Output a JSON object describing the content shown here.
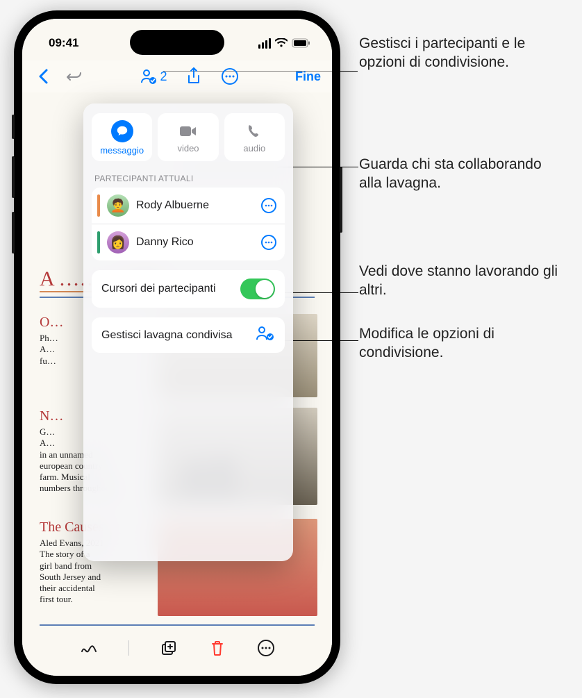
{
  "status": {
    "time": "09:41"
  },
  "toolbar": {
    "collab_count": "2",
    "done_label": "Fine"
  },
  "popover": {
    "contacts": {
      "message": "messaggio",
      "video": "video",
      "audio": "audio"
    },
    "participants_header": "PARTECIPANTI ATTUALI",
    "participants": [
      {
        "name": "Rody Albuerne",
        "presence": "#e98b4a"
      },
      {
        "name": "Danny Rico",
        "presence": "#2e9e6e"
      }
    ],
    "cursors_label": "Cursori dei partecipanti",
    "manage_label": "Gestisci lavagna condivisa"
  },
  "canvas": {
    "title": "A ……… eam",
    "para1_title": "O…",
    "para1_body": "Ph…\nA…\nfu…",
    "para2_title": "N…",
    "para2_body": "G…\nA…\nin an unnamed\neuropean country\nfarm. Musical\nnumbers throughout.",
    "para3_title": "The Causes",
    "para3_body": "Aled Evans, 2021\nThe story of a\ngirl band from\nSouth Jersey and\ntheir accidental\nfirst tour."
  },
  "callouts": {
    "c1": "Gestisci i partecipanti e le opzioni di condivisione.",
    "c2": "Guarda chi sta collaborando alla lavagna.",
    "c3": "Vedi dove stanno lavorando gli altri.",
    "c4": "Modifica le opzioni di condivisione."
  }
}
